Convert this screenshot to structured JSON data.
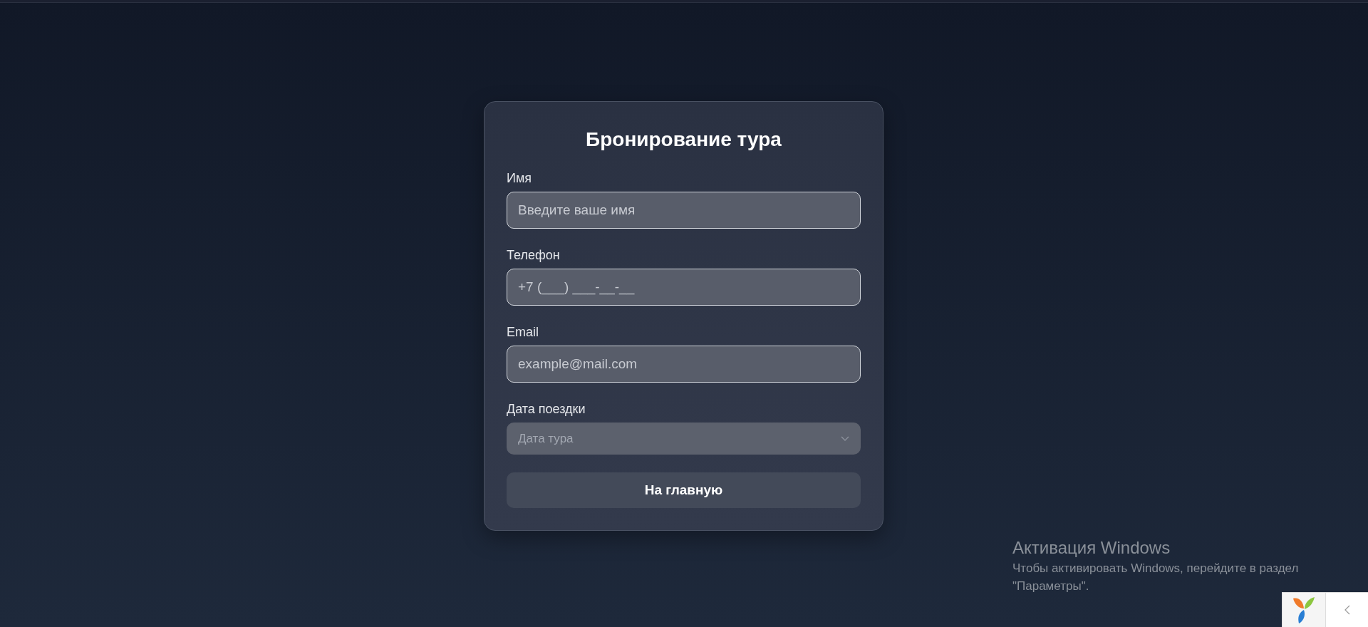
{
  "form": {
    "title": "Бронирование тура",
    "fields": [
      {
        "kind": "input",
        "label": "Имя",
        "placeholder": "Введите ваше имя",
        "disabled": false
      },
      {
        "kind": "input",
        "label": "Телефон",
        "placeholder": "+7 (___) ___-__-__",
        "disabled": false
      },
      {
        "kind": "input",
        "label": "Email",
        "placeholder": "example@mail.com",
        "disabled": false
      },
      {
        "kind": "select",
        "label": "Дата поездки",
        "placeholder": "Дата тура",
        "disabled": true
      }
    ],
    "button": "На главную"
  },
  "activation": {
    "title": "Активация Windows",
    "text": "Чтобы активировать Windows, перейдите в раздел \"Параметры\"."
  }
}
